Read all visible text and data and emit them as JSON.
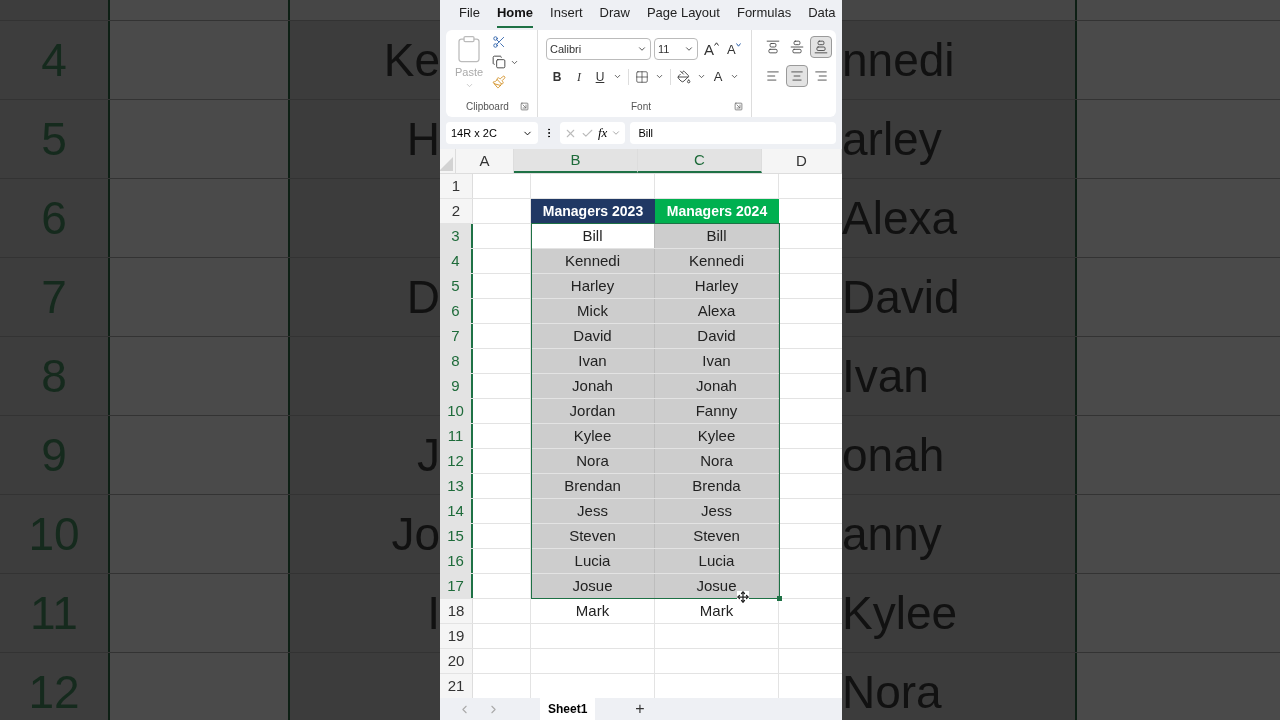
{
  "backdrop": {
    "left_rows": [
      {
        "number": "4",
        "name": "Ke"
      },
      {
        "number": "5",
        "name": "H"
      },
      {
        "number": "6"
      },
      {
        "number": "7",
        "name": "D"
      },
      {
        "number": "8"
      },
      {
        "number": "9",
        "name": "J"
      },
      {
        "number": "10",
        "name": "Jo"
      },
      {
        "number": "11",
        "name": "I"
      },
      {
        "number": "12"
      }
    ],
    "right_rows": [
      {
        "name": "nnedi"
      },
      {
        "name": "arley"
      },
      {
        "name": "Alexa"
      },
      {
        "name": "David"
      },
      {
        "name": "Ivan"
      },
      {
        "name": "onah"
      },
      {
        "name": "anny"
      },
      {
        "name": "Kylee"
      },
      {
        "name": "Nora"
      }
    ]
  },
  "menu_tabs": [
    {
      "label": "File",
      "selected": false
    },
    {
      "label": "Home",
      "selected": true
    },
    {
      "label": "Insert",
      "selected": false
    },
    {
      "label": "Draw",
      "selected": false
    },
    {
      "label": "Page Layout",
      "selected": false
    },
    {
      "label": "Formulas",
      "selected": false
    },
    {
      "label": "Data",
      "selected": false
    }
  ],
  "ribbon": {
    "clipboard": {
      "paste": "Paste",
      "label": "Clipboard"
    },
    "font": {
      "family": "Calibri",
      "size": "11",
      "grow": "A",
      "shrink": "A",
      "bold": "B",
      "italic": "I",
      "underline": "U",
      "font_color": "A",
      "label": "Font"
    },
    "vertical_align": [
      {
        "kind": "top",
        "selected": false
      },
      {
        "kind": "middle",
        "selected": false
      },
      {
        "kind": "bottom",
        "selected": true
      }
    ],
    "horizontal_align": [
      {
        "kind": "left",
        "selected": false
      },
      {
        "kind": "center",
        "selected": true
      },
      {
        "kind": "right",
        "selected": false
      }
    ]
  },
  "formula_bar": {
    "name_box": "14R x 2C",
    "fx": "fx",
    "value": "Bill"
  },
  "columns": [
    {
      "label": "A",
      "selected": false
    },
    {
      "label": "B",
      "selected": true
    },
    {
      "label": "C",
      "selected": true
    },
    {
      "label": "D",
      "selected": false
    }
  ],
  "rows": [
    {
      "number": "1",
      "selected": false
    },
    {
      "number": "2",
      "selected": false,
      "cells": [
        {
          "text": "Managers 2023",
          "kind": "header",
          "color": "#203864"
        },
        {
          "text": "Managers 2024",
          "kind": "header",
          "color": "#00b050"
        }
      ]
    },
    {
      "number": "3",
      "selected": true,
      "cells": [
        {
          "text": "Bill",
          "kind": "name",
          "selected": true,
          "active": true
        },
        {
          "text": "Bill",
          "kind": "name",
          "selected": true,
          "active": false
        }
      ]
    },
    {
      "number": "4",
      "selected": true,
      "cells": [
        {
          "text": "Kennedi",
          "kind": "name",
          "selected": true,
          "active": false
        },
        {
          "text": "Kennedi",
          "kind": "name",
          "selected": true,
          "active": false
        }
      ]
    },
    {
      "number": "5",
      "selected": true,
      "cells": [
        {
          "text": "Harley",
          "kind": "name",
          "selected": true,
          "active": false
        },
        {
          "text": "Harley",
          "kind": "name",
          "selected": true,
          "active": false
        }
      ]
    },
    {
      "number": "6",
      "selected": true,
      "cells": [
        {
          "text": "Mick",
          "kind": "name",
          "selected": true,
          "active": false
        },
        {
          "text": "Alexa",
          "kind": "name",
          "selected": true,
          "active": false
        }
      ]
    },
    {
      "number": "7",
      "selected": true,
      "cells": [
        {
          "text": "David",
          "kind": "name",
          "selected": true,
          "active": false
        },
        {
          "text": "David",
          "kind": "name",
          "selected": true,
          "active": false
        }
      ]
    },
    {
      "number": "8",
      "selected": true,
      "cells": [
        {
          "text": "Ivan",
          "kind": "name",
          "selected": true,
          "active": false
        },
        {
          "text": "Ivan",
          "kind": "name",
          "selected": true,
          "active": false
        }
      ]
    },
    {
      "number": "9",
      "selected": true,
      "cells": [
        {
          "text": "Jonah",
          "kind": "name",
          "selected": true,
          "active": false
        },
        {
          "text": "Jonah",
          "kind": "name",
          "selected": true,
          "active": false
        }
      ]
    },
    {
      "number": "10",
      "selected": true,
      "cells": [
        {
          "text": "Jordan",
          "kind": "name",
          "selected": true,
          "active": false
        },
        {
          "text": "Fanny",
          "kind": "name",
          "selected": true,
          "active": false
        }
      ]
    },
    {
      "number": "11",
      "selected": true,
      "cells": [
        {
          "text": "Kylee",
          "kind": "name",
          "selected": true,
          "active": false
        },
        {
          "text": "Kylee",
          "kind": "name",
          "selected": true,
          "active": false
        }
      ]
    },
    {
      "number": "12",
      "selected": true,
      "cells": [
        {
          "text": "Nora",
          "kind": "name",
          "selected": true,
          "active": false
        },
        {
          "text": "Nora",
          "kind": "name",
          "selected": true,
          "active": false
        }
      ]
    },
    {
      "number": "13",
      "selected": true,
      "cells": [
        {
          "text": "Brendan",
          "kind": "name",
          "selected": true,
          "active": false
        },
        {
          "text": "Brenda",
          "kind": "name",
          "selected": true,
          "active": false
        }
      ]
    },
    {
      "number": "14",
      "selected": true,
      "cells": [
        {
          "text": "Jess",
          "kind": "name",
          "selected": true,
          "active": false
        },
        {
          "text": "Jess",
          "kind": "name",
          "selected": true,
          "active": false
        }
      ]
    },
    {
      "number": "15",
      "selected": true,
      "cells": [
        {
          "text": "Steven",
          "kind": "name",
          "selected": true,
          "active": false
        },
        {
          "text": "Steven",
          "kind": "name",
          "selected": true,
          "active": false
        }
      ]
    },
    {
      "number": "16",
      "selected": true,
      "cells": [
        {
          "text": "Lucia",
          "kind": "name",
          "selected": true,
          "active": false
        },
        {
          "text": "Lucia",
          "kind": "name",
          "selected": true,
          "active": false
        }
      ]
    },
    {
      "number": "17",
      "selected": true,
      "cells": [
        {
          "text": "Josue",
          "kind": "name",
          "selected": true,
          "active": false
        },
        {
          "text": "Josue",
          "kind": "name",
          "selected": true,
          "active": false
        }
      ]
    },
    {
      "number": "18",
      "selected": false,
      "cells": [
        {
          "text": "Mark",
          "kind": "name",
          "selected": false,
          "active": false
        },
        {
          "text": "Mark",
          "kind": "name",
          "selected": false,
          "active": false
        }
      ]
    },
    {
      "number": "19",
      "selected": false
    },
    {
      "number": "20",
      "selected": false
    },
    {
      "number": "21",
      "selected": false
    }
  ],
  "sheet_tabs": [
    {
      "label": "Sheet1",
      "selected": true
    }
  ],
  "add_sheet": "+"
}
